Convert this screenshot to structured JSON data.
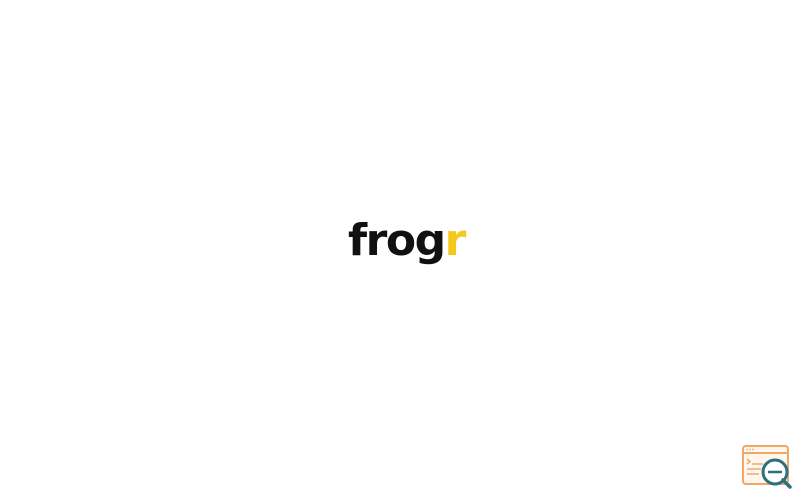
{
  "brand": {
    "logo_main": "frog",
    "logo_accent": "r",
    "main_color": "#111111",
    "accent_color": "#f5c91c"
  },
  "widget": {
    "icon": "browser-inspect-icon",
    "frame_color": "#f0a868",
    "lens_color": "#2e6f7e"
  }
}
